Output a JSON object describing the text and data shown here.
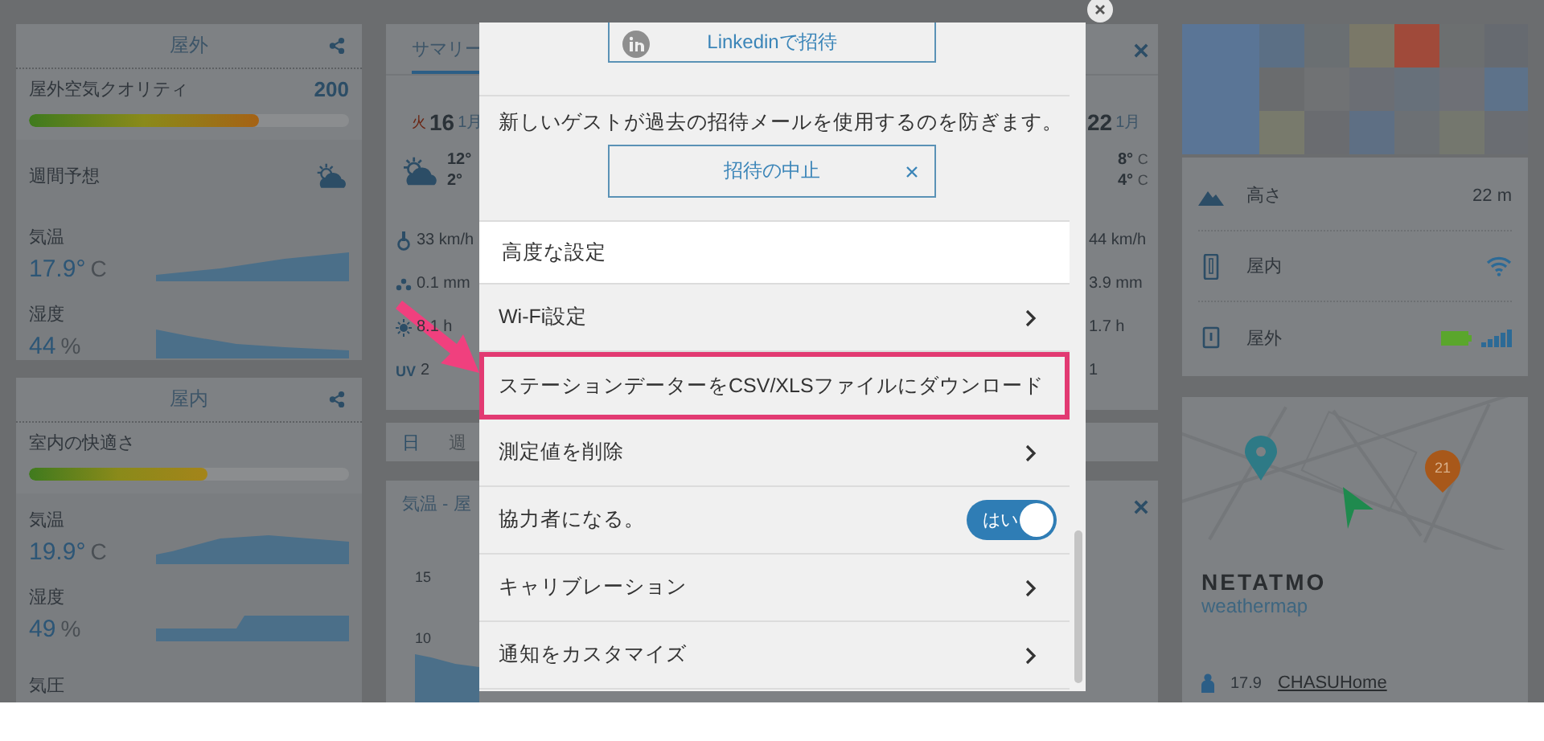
{
  "outdoor": {
    "title": "屋外",
    "air_quality": {
      "label": "屋外空気クオリティ",
      "value": "200",
      "level": 0.72
    },
    "forecast_label": "週間予想",
    "metrics": [
      {
        "label": "気温",
        "value": "17.9°",
        "unit": "C"
      },
      {
        "label": "湿度",
        "value": "44",
        "unit": "%"
      }
    ]
  },
  "indoor": {
    "title": "屋内",
    "comfort": {
      "label": "室内の快適さ",
      "level": 0.56
    },
    "metrics": [
      {
        "label": "気温",
        "value": "19.9°",
        "unit": "C"
      },
      {
        "label": "湿度",
        "value": "49",
        "unit": "%"
      },
      {
        "label": "気圧"
      }
    ]
  },
  "summary": {
    "tabs": [
      {
        "label": "サマリー",
        "selected": true
      }
    ],
    "days": [
      {
        "weekday": "火",
        "day": "16",
        "month": "1月",
        "high": "12°",
        "low": "2°",
        "wind": "33 km/h",
        "rain": "0.1 mm",
        "sun": "8.1 h",
        "uv_label": "UV",
        "uv": "2"
      },
      {
        "day": "22",
        "month": "1月",
        "high": "8°",
        "high_unit": "C",
        "low": "4°",
        "low_unit": "C",
        "wind": "44 km/h",
        "rain": "3.9 mm",
        "sun": "1.7 h",
        "uv": "1"
      }
    ]
  },
  "periods": [
    {
      "label": "日",
      "selected": true
    },
    {
      "label": "週",
      "selected": false
    }
  ],
  "chart_card": {
    "title": "気温 - 屋",
    "y_labels": [
      "15",
      "10"
    ]
  },
  "location": {
    "rows": [
      {
        "kind": "altitude",
        "label": "高さ",
        "value": "22 m"
      },
      {
        "kind": "indoor",
        "label": "屋内"
      },
      {
        "kind": "outdoor",
        "label": "屋外"
      }
    ]
  },
  "weathermap": {
    "pin_label": "21",
    "brand": "NETATMO",
    "subtitle": "weathermap",
    "temperature": "17.9",
    "station": "CHASUHome"
  },
  "modal": {
    "linkedin_button": "Linkedinで招待",
    "note": "新しいゲストが過去の招待メールを使用するのを防ぎます。",
    "stop_button": "招待の中止",
    "section_title": "高度な設定",
    "items": [
      {
        "kind": "link",
        "label": "Wi-Fi設定",
        "highlighted": false
      },
      {
        "kind": "link",
        "label": "ステーションデーターをCSV/XLSファイルにダウンロード",
        "highlighted": true
      },
      {
        "kind": "link",
        "label": "測定値を削除",
        "highlighted": false
      },
      {
        "kind": "toggle",
        "label": "協力者になる。",
        "on": true,
        "toggle_label": "はい",
        "highlighted": false
      },
      {
        "kind": "link",
        "label": "キャリブレーション",
        "highlighted": false
      },
      {
        "kind": "link",
        "label": "通知をカスタマイズ",
        "highlighted": false
      }
    ]
  }
}
